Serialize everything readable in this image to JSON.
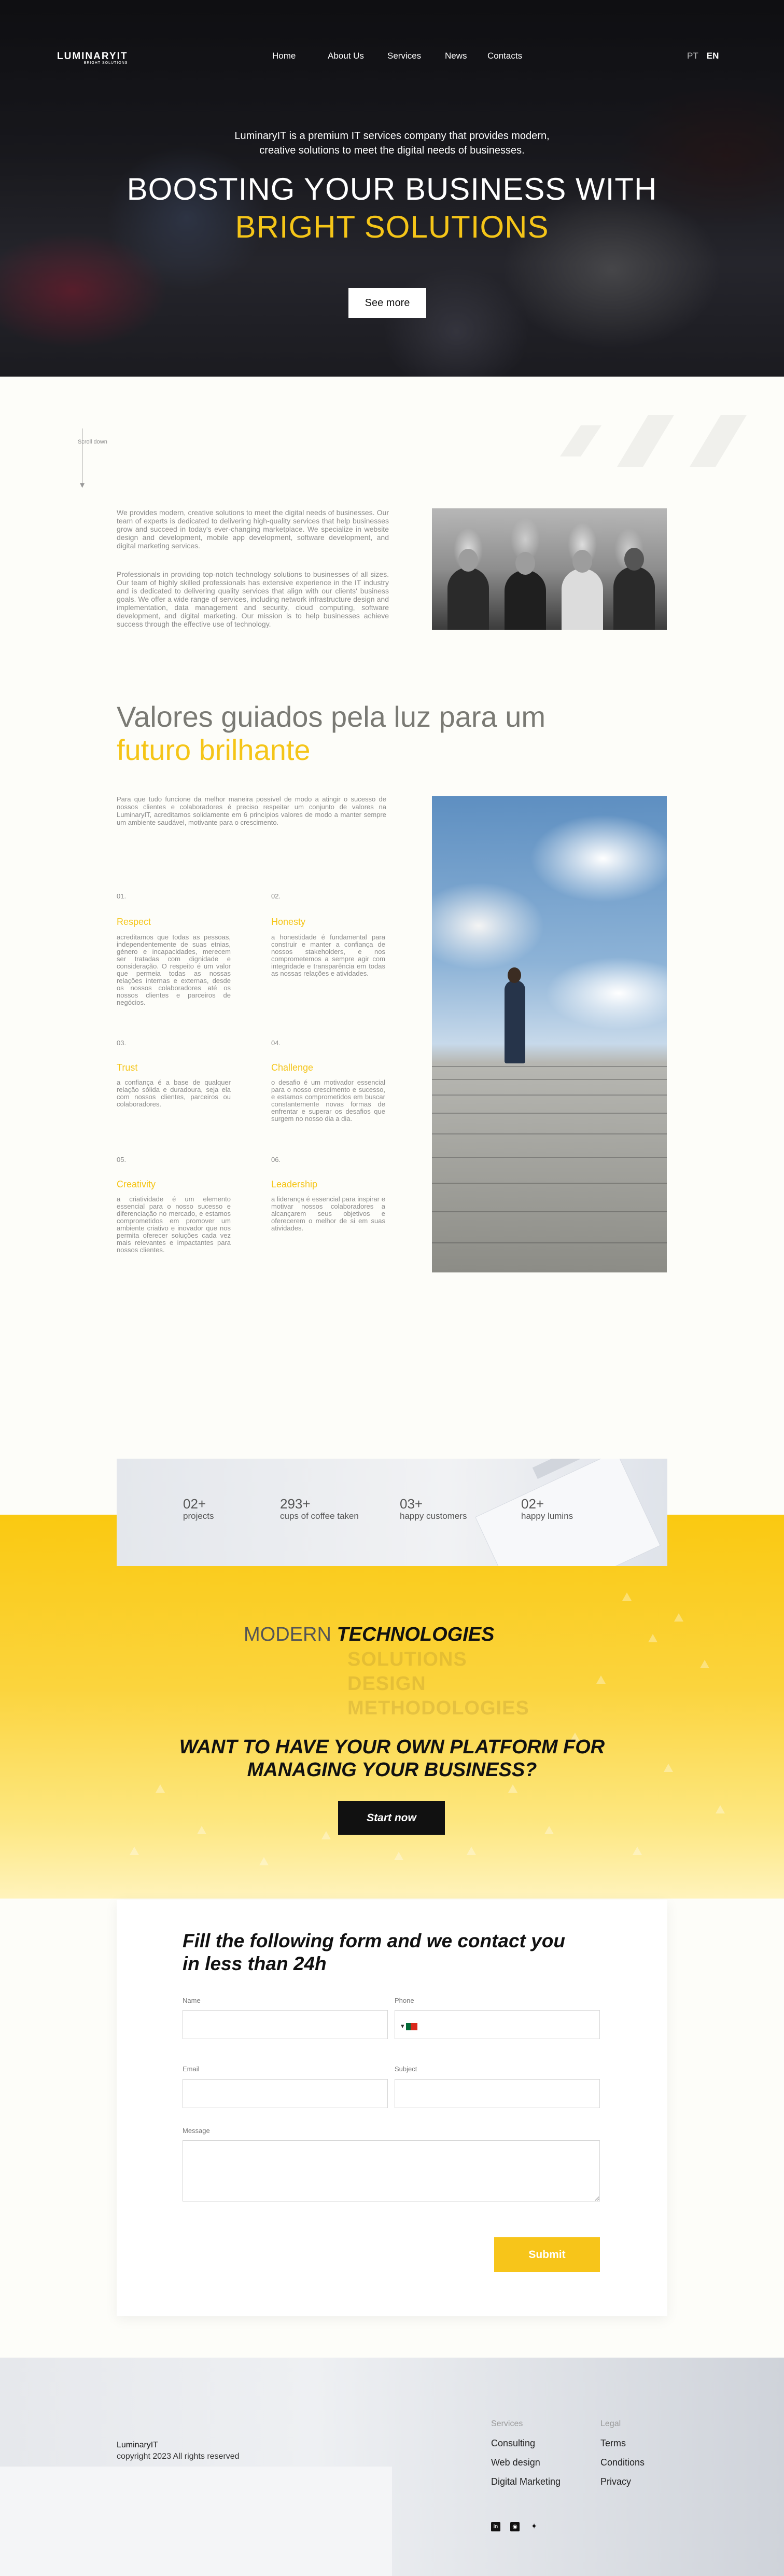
{
  "brand": {
    "name": "LuminaryIT",
    "tagline": "BRIGHT SOLUTIONS",
    "logo_text": "LUMINARYIT"
  },
  "nav": {
    "items": [
      "Home",
      "About Us",
      "Services",
      "News",
      "Contacts"
    ]
  },
  "lang": {
    "pt": "PT",
    "en": "EN"
  },
  "hero": {
    "subtitle_line1": "LuminaryIT is a premium IT services company that provides modern,",
    "subtitle_line2": "creative solutions to meet the digital needs of businesses.",
    "title_line1": "BOOSTING YOUR BUSINESS WITH",
    "title_line2": "BRIGHT SOLUTIONS",
    "cta": "See more"
  },
  "scroll": {
    "label": "Scroll down"
  },
  "intro": {
    "p1": "We provides modern, creative solutions to meet the digital needs of businesses. Our team of experts is dedicated to delivering high-quality services that help businesses grow and succeed in today's ever-changing marketplace. We specialize in website design and development, mobile app development, software development, and digital marketing services.",
    "p2": "Professionals in providing top-notch technology solutions to businesses of all sizes. Our team of highly skilled professionals has extensive experience in the IT industry and is dedicated to delivering quality services that align with our clients' business goals. We offer a wide range of services, including network infrastructure design and implementation, data management and security, cloud computing, software development, and digital marketing. Our mission is to help businesses achieve success through the effective use of technology."
  },
  "values": {
    "title_line1": "Valores guiados pela luz para um",
    "title_line2": "futuro brilhante",
    "intro": "Para que tudo funcione da melhor maneira possível de modo a atingir o sucesso de nossos clientes e colaboradores é preciso respeitar um conjunto de valores na LuminaryIT, acreditamos solidamente em 6 princípios valores de modo a manter sempre um ambiente saudável, motivante para o crescimento.",
    "items": [
      {
        "num": "01.",
        "title": "Respect",
        "desc": "acreditamos que todas as pessoas, independentemente de suas etnias, género e incapacidades, merecem ser tratadas com dignidade e consideração. O respeito é um valor que permeia todas as nossas relações internas e externas, desde os nossos colaboradores até os nossos clientes e parceiros de negócios."
      },
      {
        "num": "02.",
        "title": "Honesty",
        "desc": "a honestidade é fundamental para construir e manter a confiança de nossos stakeholders, e nos comprometemos a sempre agir com integridade e transparência em todas as nossas relações e atividades."
      },
      {
        "num": "03.",
        "title": "Trust",
        "desc": "a confiança é a base de qualquer relação sólida e duradoura, seja ela com nossos clientes, parceiros ou colaboradores."
      },
      {
        "num": "04.",
        "title": "Challenge",
        "desc": "o desafio é um motivador essencial para o nosso crescimento e sucesso, e estamos comprometidos em buscar constantemente novas formas de enfrentar e superar os desafios que surgem no nosso dia a dia."
      },
      {
        "num": "05.",
        "title": "Creativity",
        "desc": "a criatividade é um elemento essencial para o nosso sucesso e diferenciação no mercado, e estamos comprometidos em promover um ambiente criativo e inovador que nos permita oferecer soluções cada vez mais relevantes e impactantes para nossos clientes."
      },
      {
        "num": "06.",
        "title": "Leadership",
        "desc": "a liderança é essencial para inspirar e motivar nossos colaboradores a alcançarem seus objetivos e oferecerem o melhor de si em suas atividades."
      }
    ]
  },
  "stats": [
    {
      "num": "02+",
      "label": "projects"
    },
    {
      "num": "293+",
      "label": "cups of coffee taken"
    },
    {
      "num": "03+",
      "label": "happy customers"
    },
    {
      "num": "02+",
      "label": "happy lumins"
    }
  ],
  "tech": {
    "prefix": "MODERN",
    "highlight": "TECHNOLOGIES",
    "list": [
      "SOLUTIONS",
      "DESIGN",
      "METHODOLOGIES"
    ]
  },
  "cta": {
    "title_line1": "WANT TO HAVE YOUR OWN PLATFORM FOR",
    "title_line2": "MANAGING YOUR BUSINESS?",
    "button": "Start now"
  },
  "form": {
    "title_line1": "Fill the following form and we contact you",
    "title_line2": "in less than 24h",
    "name_label": "Name",
    "phone_label": "Phone",
    "email_label": "Email",
    "subject_label": "Subject",
    "message_label": "Message",
    "submit": "Submit"
  },
  "footer": {
    "brand": "LuminaryIT",
    "copyright": "copyright 2023 All rights reserved",
    "services_head": "Services",
    "services": [
      "Consulting",
      "Web design",
      "Digital Marketing"
    ],
    "legal_head": "Legal",
    "legal": [
      "Terms",
      "Conditions",
      "Privacy"
    ]
  },
  "colors": {
    "accent": "#f5c518",
    "dark": "#111111",
    "muted": "#8a8a8a"
  }
}
